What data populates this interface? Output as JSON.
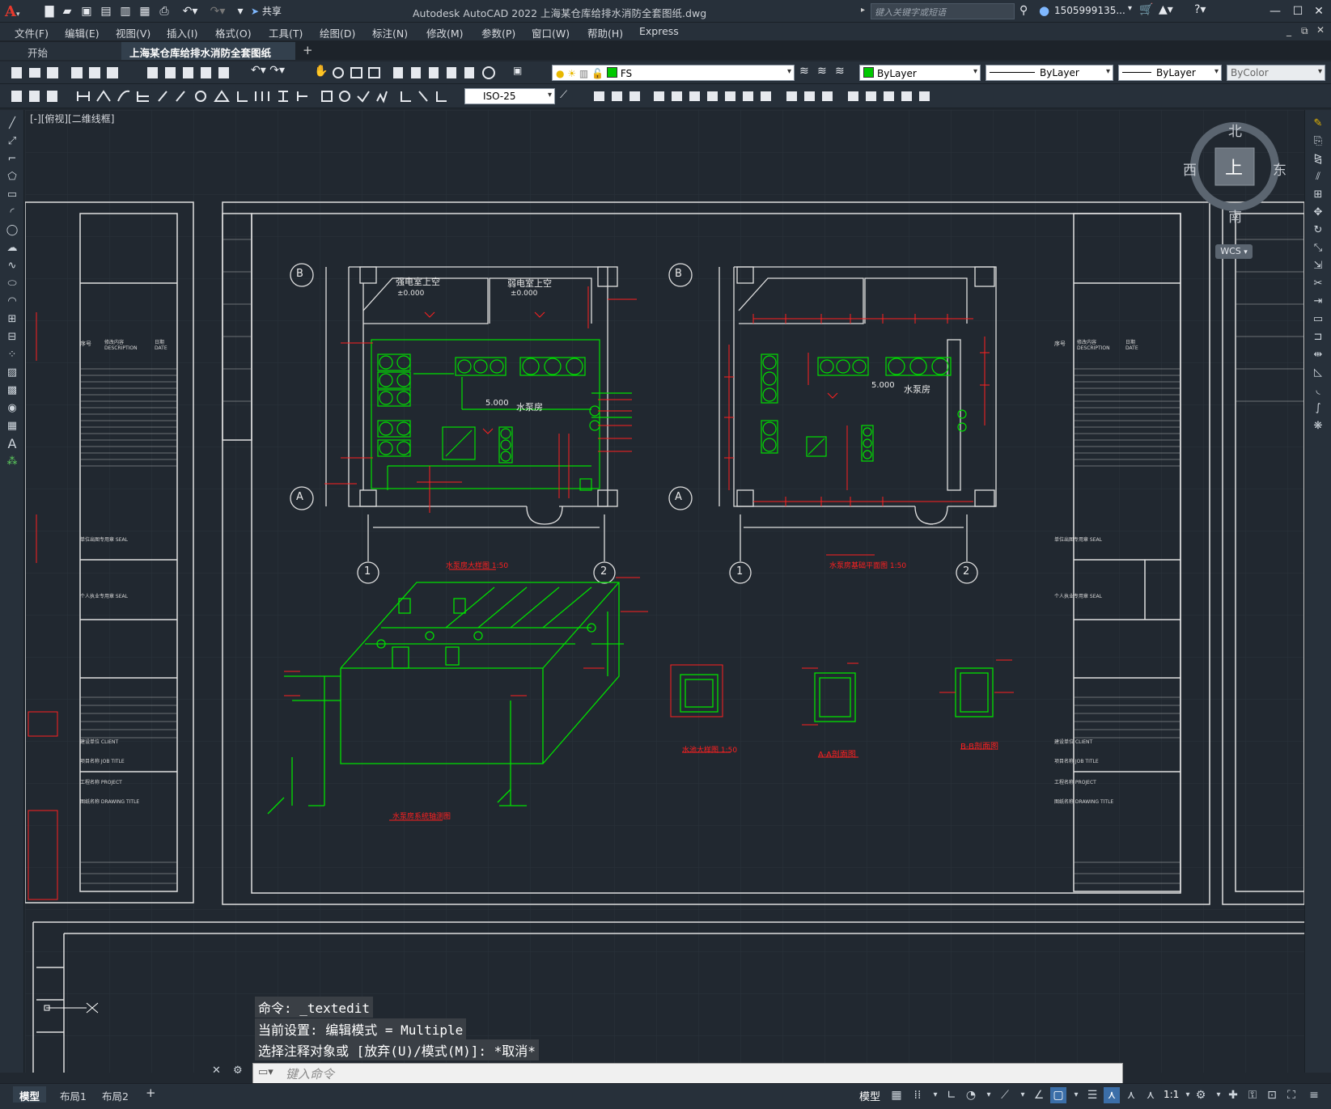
{
  "window": {
    "title": "Autodesk AutoCAD 2022    上海某仓库给排水消防全套图纸.dwg",
    "share_label": "共享",
    "search_placeholder": "键入关键字或短语",
    "user": "1505999135...",
    "controls": [
      "—",
      "☐",
      "✕"
    ]
  },
  "menu": [
    "文件(F)",
    "编辑(E)",
    "视图(V)",
    "插入(I)",
    "格式(O)",
    "工具(T)",
    "绘图(D)",
    "标注(N)",
    "修改(M)",
    "参数(P)",
    "窗口(W)",
    "帮助(H)",
    "Express"
  ],
  "tabs": {
    "start": "开始",
    "file": "上海某仓库给排水消防全套图纸*",
    "add": "+"
  },
  "toolbar": {
    "layer": "FS",
    "color": "ByLayer",
    "linetype": "ByLayer",
    "lineweight": "ByLayer",
    "plotstyle": "ByColor",
    "dimstyle": "ISO-25"
  },
  "view_label": "[-][俯视][二维线框]",
  "viewcube": {
    "north": "北",
    "south": "南",
    "east": "东",
    "west": "西",
    "face": "上",
    "wcs": "WCS"
  },
  "drawing": {
    "room1_a": "强电室上空",
    "room1_b": "弱电室上空",
    "level_zero": "±0.000",
    "pump_room": "水泵房",
    "level_5": "5.000",
    "axis_b": "B",
    "axis_a": "A",
    "axis_1": "1",
    "axis_2": "2",
    "title_plan1": "水泵房大样图 1:50",
    "title_plan2": "水泵房基础平面图 1:50",
    "title_iso": "水泵房系统轴测图",
    "title_tank": "水池大样图 1:50",
    "title_aa": "A-A剖面图",
    "title_bb": "B-B剖面图",
    "col_no": "序号",
    "col_desc": "修改内容 DESCRIPTION",
    "col_date": "日期 DATE",
    "seal1": "单位出图专用章 SEAL",
    "seal2": "个人执业专用章 SEAL",
    "client": "建设单位 CLIENT",
    "job": "项目名称 JOB TITLE",
    "project": "工程名称 PROJECT",
    "dwgtitle": "图纸名称 DRAWING TITLE"
  },
  "command": {
    "line1": "命令:  _textedit",
    "line2": "当前设置: 编辑模式 = Multiple",
    "line3": "选择注释对象或 [放弃(U)/模式(M)]: *取消*",
    "input_placeholder": "键入命令"
  },
  "layouts": [
    "模型",
    "布局1",
    "布局2",
    "+"
  ],
  "status": {
    "model": "模型",
    "scale": "1:1"
  },
  "colors": {
    "green": "#00ff00",
    "red": "#ff2020",
    "white": "#e8e8e8",
    "bg": "#212830"
  }
}
